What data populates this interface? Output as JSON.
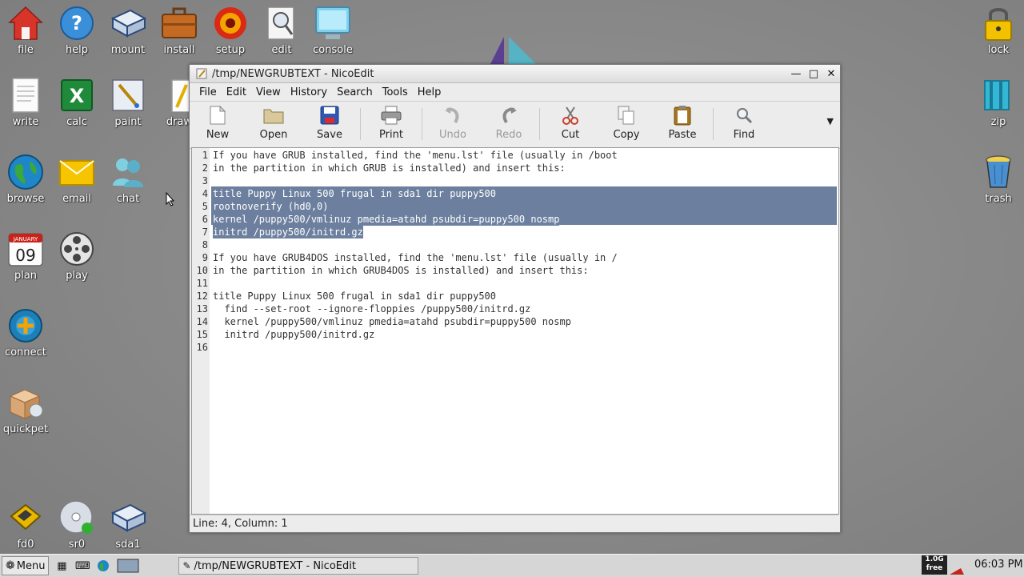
{
  "desktop": {
    "icons": [
      {
        "label": "file",
        "icon": "home-icon"
      },
      {
        "label": "help",
        "icon": "help-icon"
      },
      {
        "label": "mount",
        "icon": "drive-icon"
      },
      {
        "label": "install",
        "icon": "briefcase-icon"
      },
      {
        "label": "setup",
        "icon": "setup-icon"
      },
      {
        "label": "edit",
        "icon": "edit-icon"
      },
      {
        "label": "console",
        "icon": "monitor-icon"
      },
      {
        "label": "write",
        "icon": "document-icon"
      },
      {
        "label": "calc",
        "icon": "spreadsheet-icon"
      },
      {
        "label": "paint",
        "icon": "paint-icon"
      },
      {
        "label": "draw",
        "icon": "draw-icon"
      },
      {
        "label": "browse",
        "icon": "globe-icon"
      },
      {
        "label": "email",
        "icon": "mail-icon"
      },
      {
        "label": "chat",
        "icon": "chat-icon"
      },
      {
        "label": "plan",
        "icon": "calendar-icon"
      },
      {
        "label": "play",
        "icon": "film-reel-icon"
      },
      {
        "label": "connect",
        "icon": "connect-icon"
      },
      {
        "label": "quickpet",
        "icon": "package-icon"
      },
      {
        "label": "fd0",
        "icon": "floppy-icon"
      },
      {
        "label": "sr0",
        "icon": "cdrom-icon"
      },
      {
        "label": "sda1",
        "icon": "hard-drive-icon"
      },
      {
        "label": "lock",
        "icon": "lock-icon"
      },
      {
        "label": "zip",
        "icon": "zip-icon"
      },
      {
        "label": "trash",
        "icon": "trash-icon"
      }
    ],
    "calendar_day": "09",
    "calendar_month": "JANUARY"
  },
  "window": {
    "title": "/tmp/NEWGRUBTEXT - NicoEdit",
    "menu": [
      "File",
      "Edit",
      "View",
      "History",
      "Search",
      "Tools",
      "Help"
    ],
    "toolbar": {
      "new": "New",
      "open": "Open",
      "save": "Save",
      "print": "Print",
      "undo": "Undo",
      "redo": "Redo",
      "cut": "Cut",
      "copy": "Copy",
      "paste": "Paste",
      "find": "Find"
    },
    "lines": [
      {
        "n": "1",
        "text": "If you have GRUB installed, find the 'menu.lst' file (usually in /boot"
      },
      {
        "n": "2",
        "text": "in the partition in which GRUB is installed) and insert this:"
      },
      {
        "n": "3",
        "text": ""
      },
      {
        "n": "4",
        "text": "title Puppy Linux 500 frugal in sda1 dir puppy500",
        "selected": true
      },
      {
        "n": "5",
        "text": "rootnoverify (hd0,0)",
        "selected": true
      },
      {
        "n": "6",
        "text": "kernel /puppy500/vmlinuz pmedia=atahd psubdir=puppy500 nosmp",
        "selected": true
      },
      {
        "n": "7",
        "text": "initrd /puppy500/initrd.gz",
        "selected": true
      },
      {
        "n": "8",
        "text": ""
      },
      {
        "n": "9",
        "text": "If you have GRUB4DOS installed, find the 'menu.lst' file (usually in /"
      },
      {
        "n": "10",
        "text": "in the partition in which GRUB4DOS is installed) and insert this:"
      },
      {
        "n": "11",
        "text": ""
      },
      {
        "n": "12",
        "text": "title Puppy Linux 500 frugal in sda1 dir puppy500"
      },
      {
        "n": "13",
        "text": "  find --set-root --ignore-floppies /puppy500/initrd.gz"
      },
      {
        "n": "14",
        "text": "  kernel /puppy500/vmlinuz pmedia=atahd psubdir=puppy500 nosmp"
      },
      {
        "n": "15",
        "text": "  initrd /puppy500/initrd.gz"
      },
      {
        "n": "16",
        "text": ""
      }
    ],
    "status": "Line: 4, Column: 1"
  },
  "taskbar": {
    "menu_label": "Menu",
    "task_title": "/tmp/NEWGRUBTEXT - NicoEdit",
    "free_size": "1.0G",
    "free_label": "free",
    "clock": "06:03 PM"
  },
  "colors": {
    "selection": "#6c7f9e",
    "desktop": "#8a8a8a"
  }
}
